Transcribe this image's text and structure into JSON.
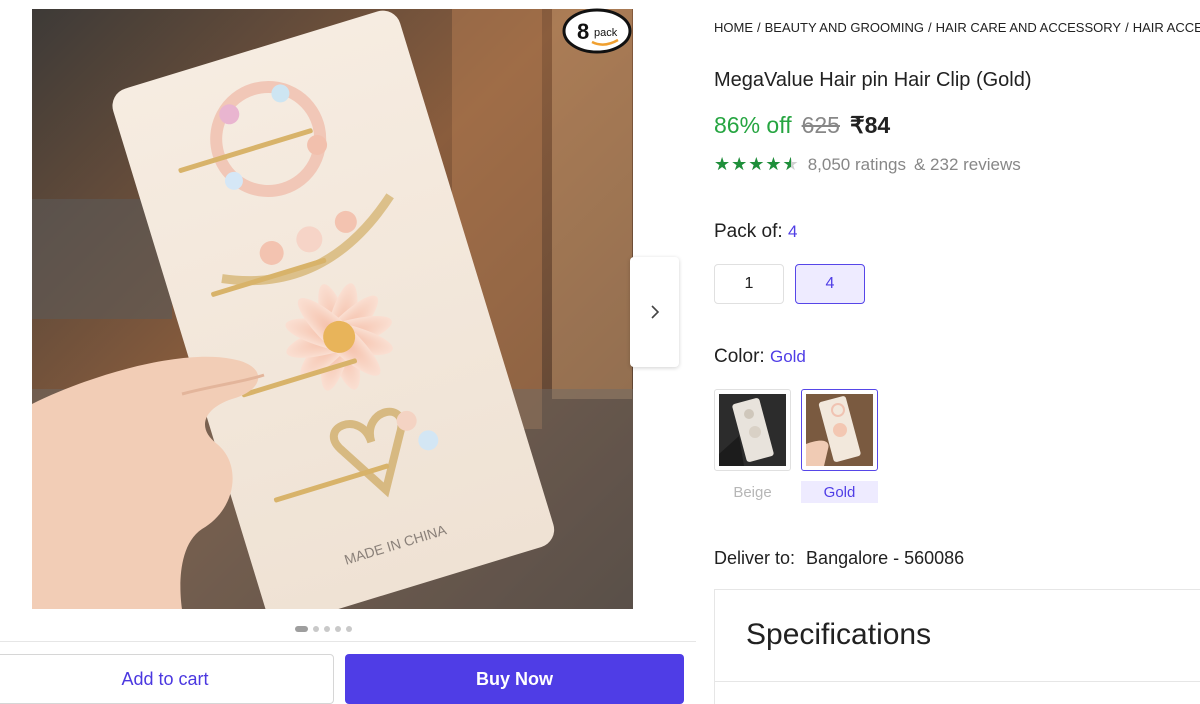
{
  "gallery": {
    "pack_badge_number": "8",
    "pack_badge_text": "pack",
    "card_text": "MADE IN CHINA",
    "dots_count": 5,
    "active_dot": 0
  },
  "actions": {
    "add_to_cart": "Add to cart",
    "buy_now": "Buy Now"
  },
  "breadcrumb": [
    "HOME",
    "BEAUTY AND GROOMING",
    "HAIR CARE AND ACCESSORY",
    "HAIR ACCESSORY"
  ],
  "product": {
    "title": "MegaValue Hair pin Hair Clip (Gold)",
    "discount": "86% off",
    "mrp": "625",
    "price": "₹84",
    "rating_stars": 4.5,
    "ratings": "8,050 ratings",
    "reviews": "& 232 reviews"
  },
  "pack": {
    "label": "Pack of:",
    "selected": "4",
    "options": [
      "1",
      "4"
    ]
  },
  "color": {
    "label": "Color:",
    "selected": "Gold",
    "options": [
      "Beige",
      "Gold"
    ]
  },
  "delivery": {
    "label": "Deliver to:",
    "location": "Bangalore - 560086"
  },
  "specs": {
    "title": "Specifications"
  },
  "colors": {
    "accent": "#4f3de6",
    "discount_green": "#26a541",
    "star_green": "#1e8f3a"
  }
}
